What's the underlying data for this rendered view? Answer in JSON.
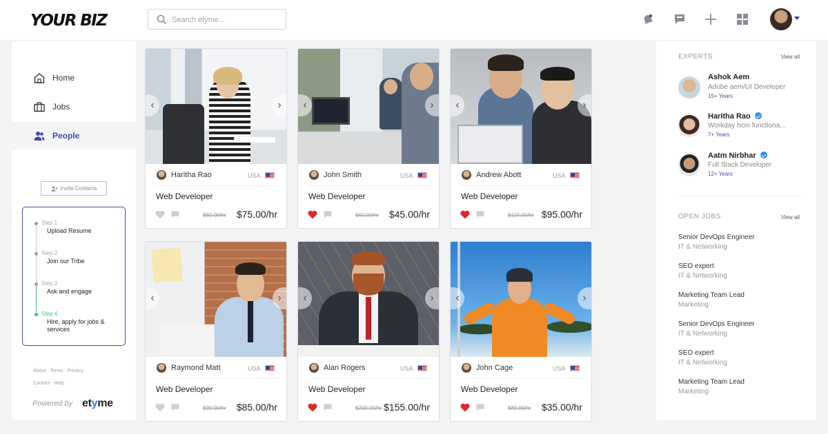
{
  "header": {
    "logo": "YOUR BIZ",
    "search_placeholder": "Search etyme..."
  },
  "sidebar": {
    "items": [
      {
        "label": "Home"
      },
      {
        "label": "Jobs"
      },
      {
        "label": "People",
        "active": true
      }
    ],
    "invite_label": "Invite Contacts",
    "steps": [
      {
        "number": "Step 1",
        "title": "Upload Resume"
      },
      {
        "number": "Step 2",
        "title": "Join our Tribe"
      },
      {
        "number": "Step 3",
        "title": "Ask and engage"
      },
      {
        "number": "Step 4",
        "title": "Hire, apply for jobs & services"
      }
    ],
    "footer_links_1": "About · Terms · Privacy",
    "footer_links_2": "Contact · Help",
    "powered_by": "Powered by",
    "brand_pre": "et",
    "brand_y": "y",
    "brand_post": "me"
  },
  "people": [
    {
      "name": "Haritha Rao",
      "country": "USA",
      "role": "Web Developer",
      "old_price": "$80.00/hr",
      "price": "$75.00/hr",
      "liked": false
    },
    {
      "name": "John Smith",
      "country": "USA",
      "role": "Web Developer",
      "old_price": "$60.00/hr",
      "price": "$45.00/hr",
      "liked": true
    },
    {
      "name": "Andrew Abott",
      "country": "USA",
      "role": "Web Developer",
      "old_price": "$115.00/hr",
      "price": "$95.00/hr",
      "liked": true
    },
    {
      "name": "Raymond Matt",
      "country": "USA",
      "role": "Web Developer",
      "old_price": "$90.00/hr",
      "price": "$85.00/hr",
      "liked": false
    },
    {
      "name": "Alan Rogers",
      "country": "USA",
      "role": "Web Developer",
      "old_price": "$200.00/hr",
      "price": "$155.00/hr",
      "liked": true
    },
    {
      "name": "John Cage",
      "country": "USA",
      "role": "Web Developer",
      "old_price": "$80.00/hr",
      "price": "$35.00/hr",
      "liked": true
    }
  ],
  "experts": {
    "heading": "EXPERTS",
    "view_all": "View all",
    "list": [
      {
        "name": "Ashok Aem",
        "title": "Adobe aem/UI Developer",
        "years": "15+ Years",
        "verified": false
      },
      {
        "name": "Haritha Rao",
        "title": "Workday hcm functiona...",
        "years": "7+ Years",
        "verified": true
      },
      {
        "name": "Aatm Nirbhar",
        "title": "Full Stack Developer",
        "years": "12+ Years",
        "verified": true
      }
    ]
  },
  "open_jobs": {
    "heading": "OPEN JOBS",
    "view_all": "View all",
    "list": [
      {
        "title": "Senior DevOps Engineer",
        "category": "IT & Networking"
      },
      {
        "title": "SEO expert",
        "category": "IT & Networking"
      },
      {
        "title": "Marketing Team Lead",
        "category": "Marketing"
      },
      {
        "title": "Senior DevOps Engineer",
        "category": "IT & Networking"
      },
      {
        "title": "SEO expert",
        "category": "IT & Networking"
      },
      {
        "title": "Marketing Team Lead",
        "category": "Marketing"
      }
    ]
  },
  "colors": {
    "accent": "#3f4ba8",
    "heart_active": "#e0262d",
    "step_done": "#40c070",
    "verified": "#2b8fe6"
  }
}
